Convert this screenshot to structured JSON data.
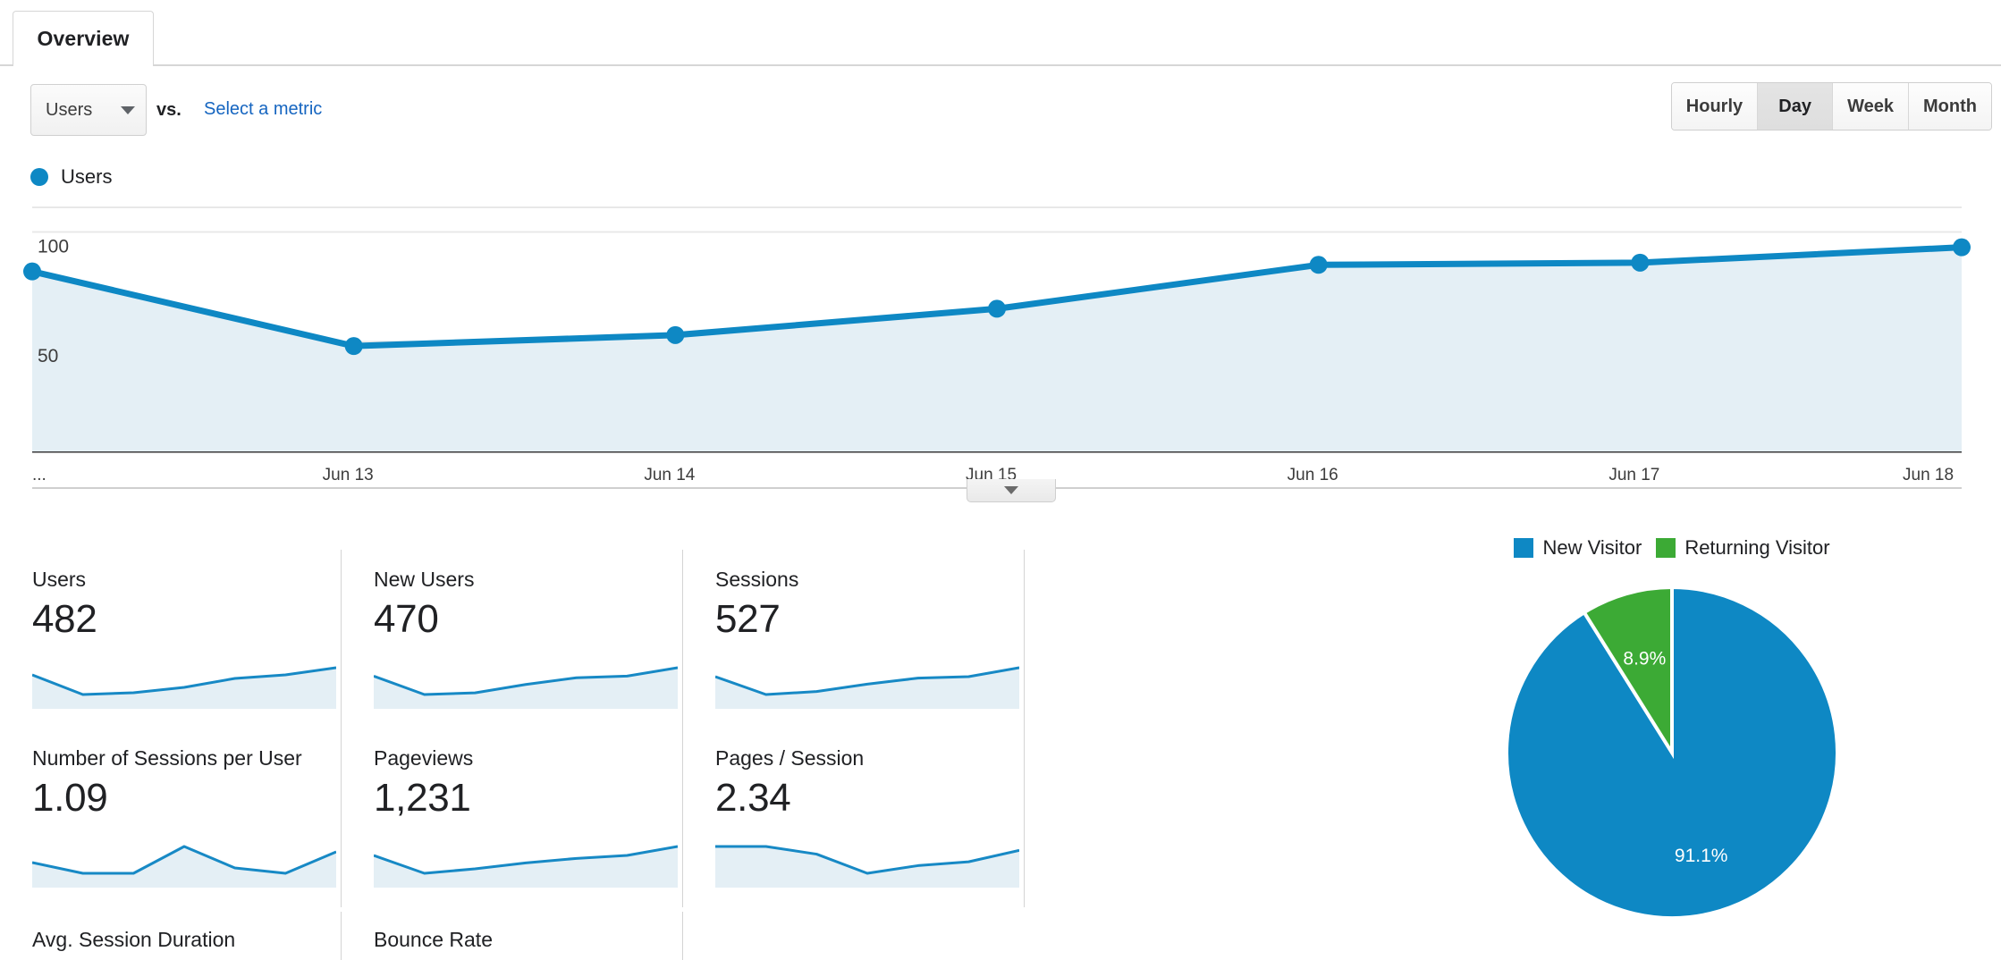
{
  "tab": {
    "label": "Overview"
  },
  "controls": {
    "metric_select_value": "Users",
    "vs_label": "vs.",
    "select_metric_link": "Select a metric",
    "granularity": [
      {
        "label": "Hourly",
        "active": false
      },
      {
        "label": "Day",
        "active": true
      },
      {
        "label": "Week",
        "active": false
      },
      {
        "label": "Month",
        "active": false
      }
    ]
  },
  "chart_legend": {
    "label": "Users",
    "color": "#0e88c4"
  },
  "chart_data": {
    "type": "line",
    "title": "Users",
    "xlabel": "",
    "ylabel": "Users",
    "x": [
      "...",
      "Jun 13",
      "Jun 14",
      "Jun 15",
      "Jun 16",
      "Jun 17",
      "Jun 18"
    ],
    "series": [
      {
        "name": "Users",
        "values": [
          82,
          48,
          53,
          65,
          85,
          86,
          93
        ]
      }
    ],
    "yticks": [
      50,
      100
    ],
    "ylim": [
      0,
      112
    ],
    "grid": true,
    "legend_position": "top-left",
    "line_color": "#0e88c4",
    "area_color": "#e4eff5"
  },
  "cards": [
    {
      "title": "Users",
      "value": "482",
      "spark": [
        62,
        40,
        42,
        48,
        58,
        62,
        70
      ]
    },
    {
      "title": "New Users",
      "value": "470",
      "spark": [
        60,
        38,
        40,
        50,
        58,
        60,
        70
      ]
    },
    {
      "title": "Sessions",
      "value": "527",
      "spark": [
        58,
        34,
        38,
        48,
        56,
        58,
        70
      ]
    },
    {
      "title": "Number of Sessions per User",
      "value": "1.09",
      "spark": [
        62,
        58,
        58,
        68,
        60,
        58,
        66
      ]
    },
    {
      "title": "Pageviews",
      "value": "1,231",
      "spark": [
        58,
        34,
        40,
        48,
        54,
        58,
        70
      ]
    },
    {
      "title": "Pages / Session",
      "value": "2.34",
      "spark": [
        66,
        66,
        62,
        52,
        56,
        58,
        64
      ]
    }
  ],
  "cards_partial": [
    {
      "title": "Avg. Session Duration"
    },
    {
      "title": "Bounce Rate"
    },
    {
      "title": ""
    }
  ],
  "pie": {
    "legend": [
      {
        "label": "New Visitor",
        "color": "#0e88c4"
      },
      {
        "label": "Returning Visitor",
        "color": "#3caa35"
      }
    ],
    "chart_data": {
      "type": "pie",
      "title": "",
      "labels": [
        "New Visitor",
        "Returning Visitor"
      ],
      "values": [
        91.1,
        8.9
      ],
      "value_labels": [
        "91.1%",
        "8.9%"
      ],
      "colors": [
        "#0e88c4",
        "#3caa35"
      ],
      "legend_position": "top"
    }
  }
}
